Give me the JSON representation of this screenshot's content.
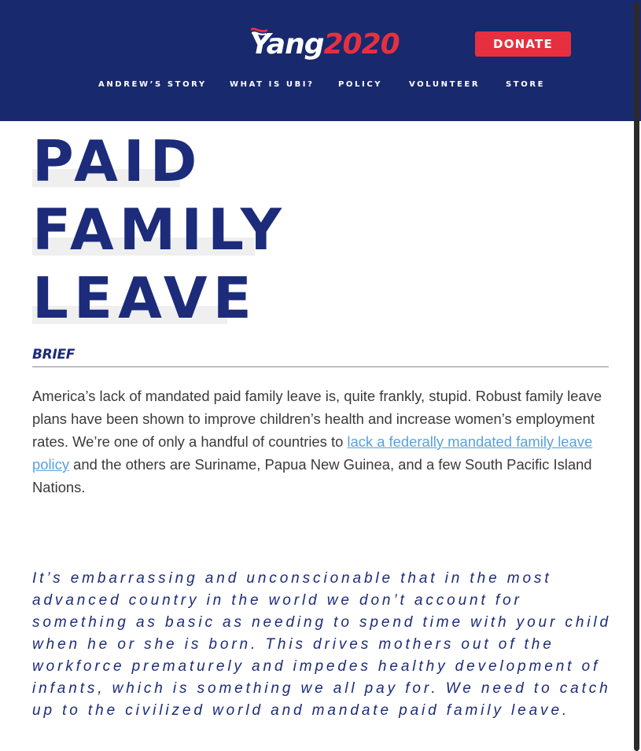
{
  "header": {
    "logo": {
      "name": "Yang",
      "year": "2020"
    },
    "donate_label": "DONATE",
    "nav": [
      {
        "label": "ANDREW’S STORY"
      },
      {
        "label": "WHAT IS UBI?"
      },
      {
        "label": "POLICY"
      },
      {
        "label": "VOLUNTEER"
      },
      {
        "label": "STORE"
      }
    ]
  },
  "page": {
    "title_lines": [
      "PAID",
      "FAMILY",
      "LEAVE"
    ],
    "brief_label": "BRIEF",
    "brief": {
      "before_link": "America’s lack of mandated paid family leave is, quite frankly, stupid. Robust family leave plans have been shown to improve children’s health and increase women’s employment rates. We’re one of only a handful of countries to ",
      "link_text": "lack a federally mandated family leave policy",
      "after_link": " and the others are Suriname, Papua New Guinea, and a few South Pacific Island Nations."
    },
    "quote": "It’s embarrassing and unconscionable that in the most advanced country in the world we don’t account for something as basic as needing to spend time with your child when he or she is born. This drives mothers out of the workforce prematurely and impedes healthy development of infants, which is something we all pay for. We need to catch up to the civilized world and mandate paid family leave."
  },
  "colors": {
    "header_bg": "#18296d",
    "accent_red": "#e6303f",
    "title_blue": "#1c2b7a",
    "link_blue": "#5aa0db",
    "body_text": "#3a3a3a"
  }
}
